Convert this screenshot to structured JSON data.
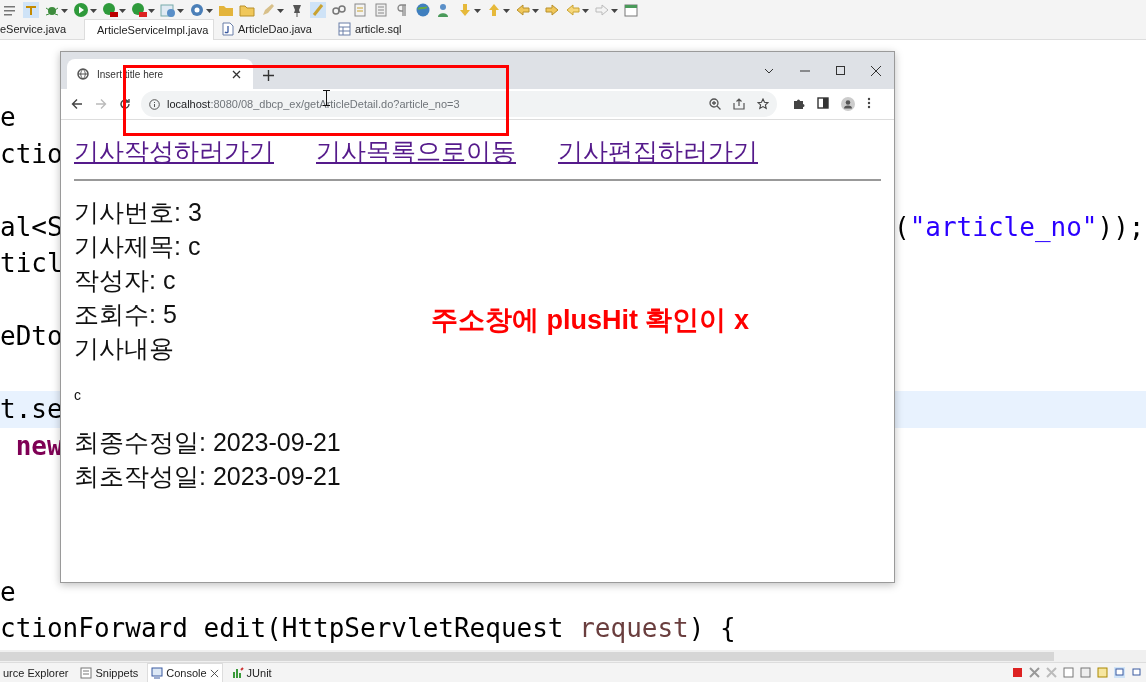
{
  "ide": {
    "editor_tabs": [
      {
        "label": "eService.java",
        "kind": "none",
        "selected": false
      },
      {
        "label": "ArticleServiceImpl.java",
        "kind": "java",
        "selected": true
      },
      {
        "label": "ArticleDao.java",
        "kind": "java",
        "selected": false
      },
      {
        "label": "article.sql",
        "kind": "sql",
        "selected": false
      }
    ],
    "code_lines": [
      {
        "highlighted": false,
        "left": [
          {
            "text": "e",
            "kind": "plain"
          }
        ]
      },
      {
        "highlighted": false,
        "left": [
          {
            "text": "ctio",
            "kind": "plain"
          }
        ]
      },
      {
        "highlighted": false
      },
      {
        "highlighted": false,
        "left": [
          {
            "text": "al<S",
            "kind": "plain"
          }
        ],
        "right": [
          {
            "text": "(",
            "kind": "plain"
          },
          {
            "text": "\"article_no\"",
            "kind": "string"
          },
          {
            "text": "));",
            "kind": "plain"
          }
        ]
      },
      {
        "highlighted": false,
        "left": [
          {
            "text": "ticl",
            "kind": "plain"
          }
        ]
      },
      {
        "highlighted": false
      },
      {
        "highlighted": false,
        "left": [
          {
            "text": "eDto",
            "kind": "plain"
          }
        ]
      },
      {
        "highlighted": false
      },
      {
        "highlighted": true,
        "left": [
          {
            "text": "t.se",
            "kind": "plain"
          }
        ]
      },
      {
        "highlighted": false,
        "left": [
          {
            "text": " new",
            "kind": "keyword"
          }
        ]
      },
      {
        "highlighted": false
      },
      {
        "highlighted": false
      },
      {
        "highlighted": false
      },
      {
        "highlighted": false,
        "left": [
          {
            "text": "e",
            "kind": "plain"
          }
        ]
      },
      {
        "highlighted": false,
        "left": [
          {
            "text": "ctionForward edit(HttpServletRequest ",
            "kind": "plain"
          },
          {
            "text": "request",
            "kind": "variable"
          },
          {
            "text": ") {",
            "kind": "plain"
          }
        ]
      }
    ],
    "bottom_tabs": [
      {
        "label": "urce Explorer",
        "kind": "none",
        "selected": false
      },
      {
        "label": "Snippets",
        "kind": "snippets",
        "selected": false
      },
      {
        "label": "Console",
        "kind": "console",
        "selected": true
      },
      {
        "label": "JUnit",
        "kind": "junit",
        "selected": false
      }
    ]
  },
  "browser": {
    "tab": {
      "title": "Insert title here"
    },
    "address": {
      "host": "localhost",
      "path": ":8080/08_dbcp_ex/getArticleDetail.do?article_no=3"
    },
    "links": [
      "기사작성하러가기",
      "기사목록으로이동",
      "기사편집하러가기"
    ],
    "lines": [
      {
        "text": "기사번호: 3",
        "kind": "field"
      },
      {
        "text": "기사제목: c",
        "kind": "field"
      },
      {
        "text": "작성자: c",
        "kind": "field"
      },
      {
        "text": "조회수: 5",
        "kind": "field"
      },
      {
        "text": "기사내용",
        "kind": "field"
      },
      {
        "text": "c",
        "kind": "body"
      },
      {
        "text": "최종수정일: 2023-09-21",
        "kind": "field"
      },
      {
        "text": "최초작성일: 2023-09-21",
        "kind": "field"
      }
    ]
  },
  "annotation": {
    "text": "주소창에 plusHit 확인이 x"
  }
}
